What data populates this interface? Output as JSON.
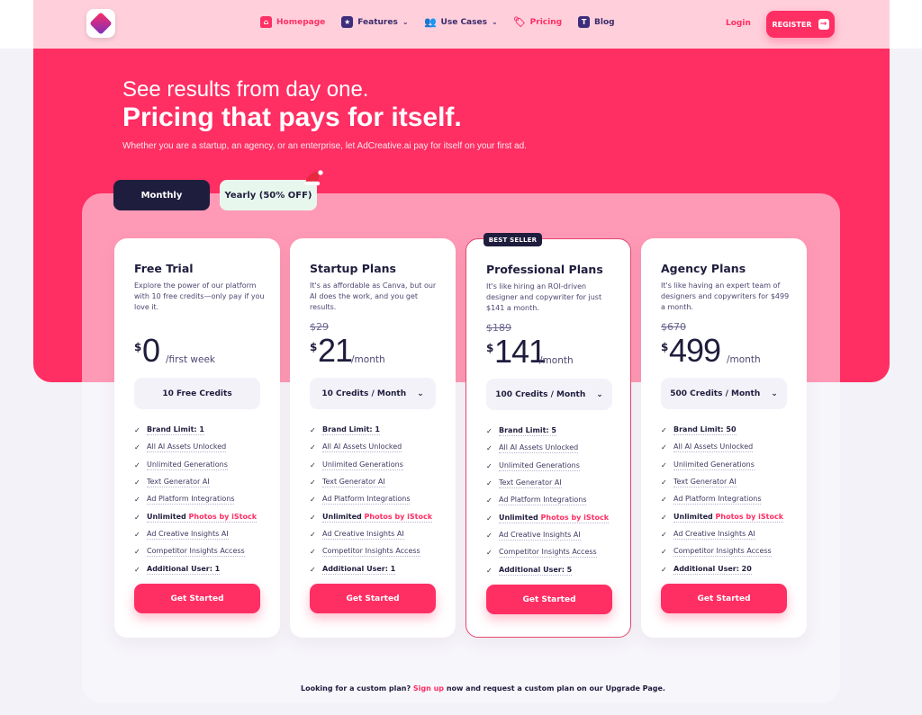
{
  "nav": {
    "items": [
      {
        "label": "Homepage",
        "icon": "home-icon",
        "active": true
      },
      {
        "label": "Features",
        "icon": "star-icon",
        "dropdown": true
      },
      {
        "label": "Use Cases",
        "icon": "users-icon",
        "dropdown": true
      },
      {
        "label": "Pricing",
        "icon": "tag-icon",
        "active": true
      },
      {
        "label": "Blog",
        "icon": "blog-icon"
      }
    ],
    "login": "Login",
    "register": "REGISTER"
  },
  "hero": {
    "subtitle": "See results from day one.",
    "title": "Pricing that pays for itself.",
    "description": "Whether you are a startup, an agency, or an enterprise, let AdCreative.ai pay for itself on your first ad."
  },
  "billing_toggle": {
    "monthly": "Monthly",
    "yearly": "Yearly (50% OFF)",
    "selected": "Monthly"
  },
  "plans": [
    {
      "title": "Free Trial",
      "description": "Explore the power of our platform with 10 free credits—only pay if you love it.",
      "old_price": "",
      "currency": "$",
      "price": "0",
      "period": "/first week",
      "credits": "10 Free Credits",
      "credits_dropdown": false,
      "features": {
        "brand_limit": "Brand Limit: 1",
        "assets": "All AI Assets Unlocked",
        "generations": "Unlimited Generations",
        "text_ai": "Text Generator AI",
        "integrations": "Ad Platform Integrations",
        "photos_prefix": "Unlimited ",
        "photos_link": "Photos by iStock",
        "insights": "Ad Creative Insights AI",
        "competitor": "Competitor Insights Access",
        "users": "Additional User: 1"
      },
      "cta": "Get Started"
    },
    {
      "title": "Startup Plans",
      "description": "It's as affordable as Canva, but our AI does the work, and you get results.",
      "old_price": "$29",
      "currency": "$",
      "price": "21",
      "period": "/month",
      "credits": "10 Credits / Month",
      "credits_dropdown": true,
      "features": {
        "brand_limit": "Brand Limit: 1",
        "assets": "All AI Assets Unlocked",
        "generations": "Unlimited Generations",
        "text_ai": "Text Generator AI",
        "integrations": "Ad Platform Integrations",
        "photos_prefix": "Unlimited ",
        "photos_link": "Photos by iStock",
        "insights": "Ad Creative Insights AI",
        "competitor": "Competitor Insights Access",
        "users": "Additional User: 1"
      },
      "cta": "Get Started"
    },
    {
      "title": "Professional Plans",
      "badge": "BEST SELLER",
      "description": "It's like hiring an ROI-driven designer and copywriter for just $141 a month.",
      "old_price": "$189",
      "currency": "$",
      "price": "141",
      "period": "/month",
      "credits": "100 Credits / Month",
      "credits_dropdown": true,
      "features": {
        "brand_limit": "Brand Limit: 5",
        "assets": "All AI Assets Unlocked",
        "generations": "Unlimited Generations",
        "text_ai": "Text Generator AI",
        "integrations": "Ad Platform Integrations",
        "photos_prefix": "Unlimited ",
        "photos_link": "Photos by iStock",
        "insights": "Ad Creative Insights AI",
        "competitor": "Competitor Insights Access",
        "users": "Additional User: 5"
      },
      "cta": "Get Started"
    },
    {
      "title": "Agency Plans",
      "description": "It's like having an expert team of designers and copywriters for $499 a month.",
      "old_price": "$670",
      "currency": "$",
      "price": "499",
      "period": "/month",
      "credits": "500 Credits / Month",
      "credits_dropdown": true,
      "features": {
        "brand_limit": "Brand Limit: 50",
        "assets": "All AI Assets Unlocked",
        "generations": "Unlimited Generations",
        "text_ai": "Text Generator AI",
        "integrations": "Ad Platform Integrations",
        "photos_prefix": "Unlimited ",
        "photos_link": "Photos by iStock",
        "insights": "Ad Creative Insights AI",
        "competitor": "Competitor Insights Access",
        "users": "Additional User: 20"
      },
      "cta": "Get Started"
    }
  ],
  "footer": {
    "before": "Looking for a custom plan? ",
    "link": "Sign up",
    "after": " now and request a custom plan on our Upgrade Page."
  },
  "colors": {
    "brand": "#ff2e63",
    "dark": "#1f1d3d",
    "nav_bg": "#ffd0dc",
    "panel": "#ff9ab6"
  }
}
